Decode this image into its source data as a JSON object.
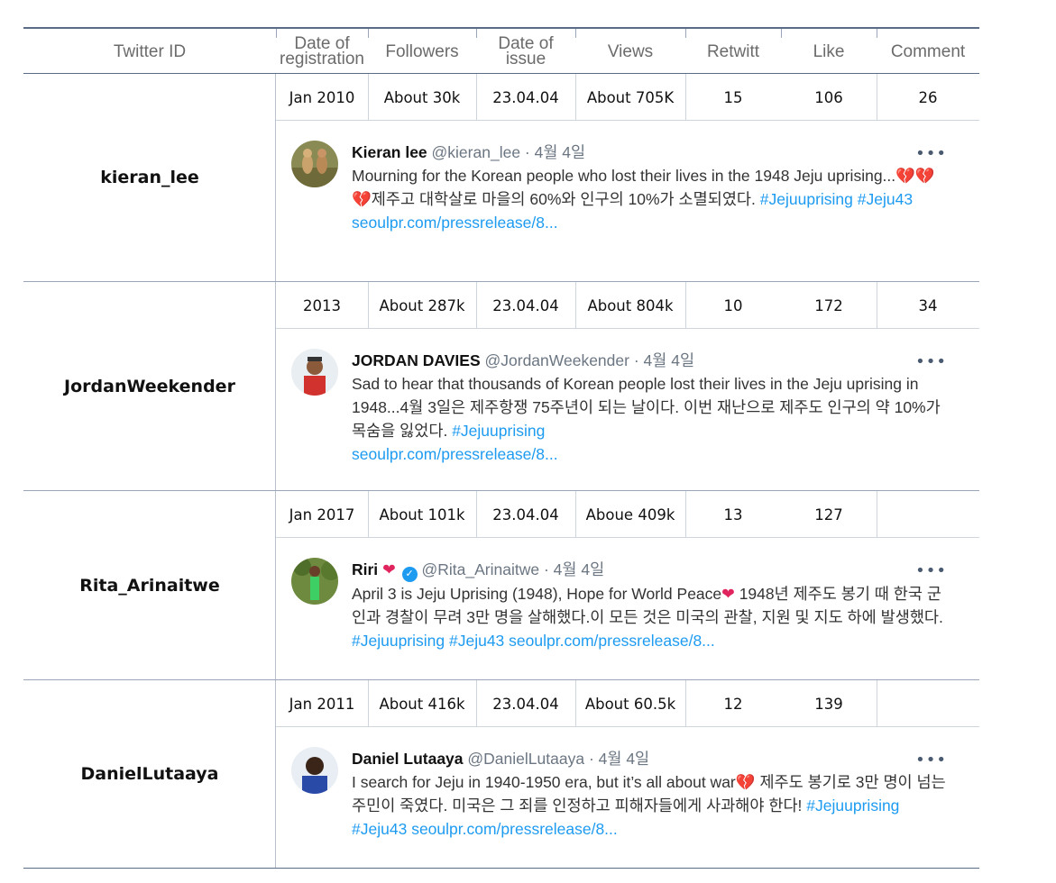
{
  "headers": [
    "Twitter ID",
    "Date of registration",
    "Followers",
    "Date of issue",
    "Views",
    "Retwitt",
    "Like",
    "Comment"
  ],
  "rows": [
    {
      "id": "kieran_lee",
      "stats": [
        "Jan 2010",
        "About 30k",
        "23.04.04",
        "About 705K",
        "15",
        "106",
        "26"
      ],
      "name": "Kieran lee",
      "handle": "@kieran_lee",
      "date": "· 4월 4일",
      "text_pre": "Mourning for the Korean people who lost their lives in the 1948 Jeju uprising...",
      "emoji": "💔💔💔",
      "text_post": "제주고 대학살로 마을의 60%와 인구의 10%가 소멸되였다.",
      "tags": "#Jejuuprising #Jeju43",
      "link": "seoulpr.com/pressrelease/8..."
    },
    {
      "id": "JordanWeekender",
      "stats": [
        "2013",
        "About 287k",
        "23.04.04",
        "About 804k",
        "10",
        "172",
        "34"
      ],
      "name": "JORDAN DAVIES",
      "handle": "@JordanWeekender",
      "date": "· 4월 4일",
      "text_pre": "Sad to hear that thousands of Korean people lost their lives in the Jeju uprising in 1948...4월 3일은 제주항쟁 75주년이 되는 날이다. 이번 재난으로 제주도 인구의 약 10%가 목숨을 잃었다.",
      "tags": "#Jejuuprising",
      "link": "seoulpr.com/pressrelease/8..."
    },
    {
      "id": "Rita_Arinaitwe",
      "stats": [
        "Jan 2017",
        "About 101k",
        "23.04.04",
        "Aboue 409k",
        "13",
        "127",
        ""
      ],
      "name": "Riri",
      "handle": "@Rita_Arinaitwe",
      "date": "· 4월 4일",
      "text_pre": "April 3 is Jeju Uprising (1948), Hope for World Peace",
      "text_post": "1948년 제주도 봉기 때 한국 군인과 경찰이 무려 3만 명을 살해했다.이 모든 것은 미국의 관찰, 지원 및 지도 하에 발생했다.",
      "tags": "#Jejuuprising #Jeju43",
      "link": "seoulpr.com/pressrelease/8..."
    },
    {
      "id": "DanielLutaaya",
      "stats": [
        "Jan 2011",
        "About 416k",
        "23.04.04",
        "About 60.5k",
        "12",
        "139",
        ""
      ],
      "name": "Daniel Lutaaya",
      "handle": "@DanielLutaaya",
      "date": "· 4월 4일",
      "text_pre": "I search for Jeju in 1940-1950 era, but it’s all about war",
      "text_post": "제주도 봉기로 3만 명이 넘는 주민이 죽였다. 미국은 그 죄를 인정하고 피해자들에게 사과해야 한다!",
      "tags": "#Jejuuprising #Jeju43",
      "link": "seoulpr.com/pressrelease/8..."
    }
  ],
  "icons": {
    "more": "more-icon",
    "heart": "heart-icon",
    "broken_heart": "broken-heart-icon",
    "verified": "verified-badge-icon"
  },
  "colors": {
    "accent_link": "#1d9bf0",
    "border": "#5a6c86",
    "heart": "#e0245e"
  }
}
